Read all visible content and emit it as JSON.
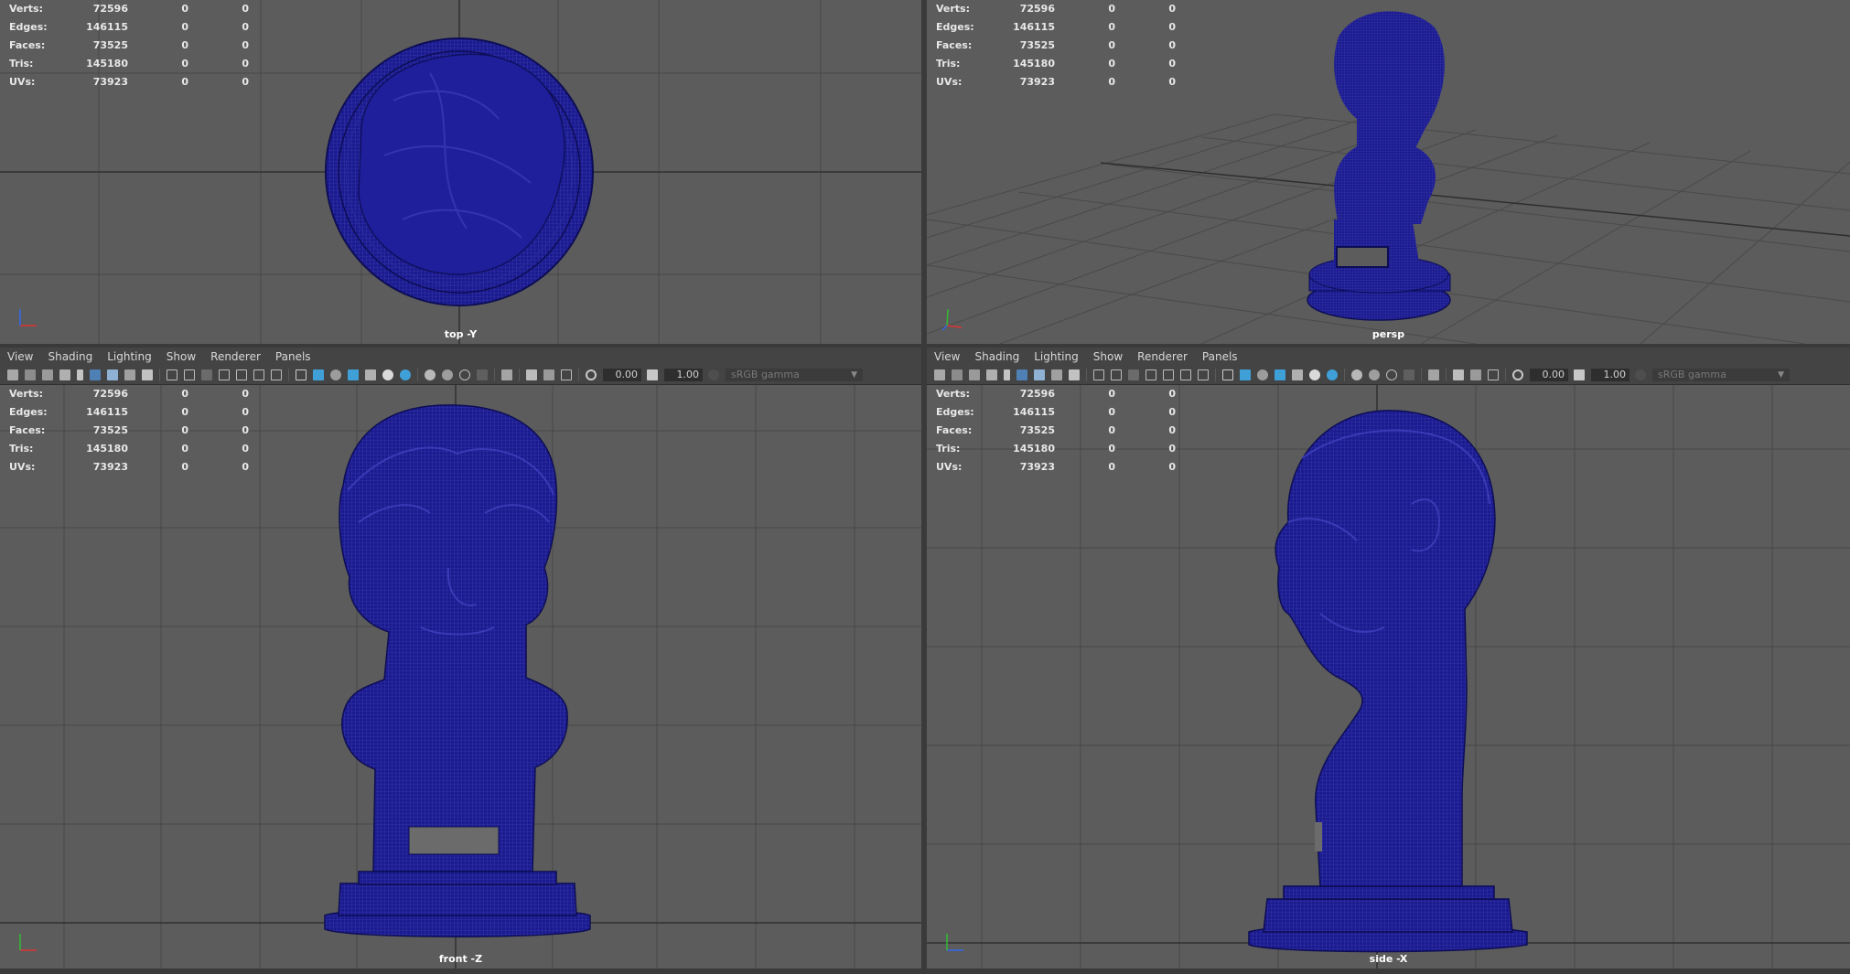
{
  "stats_labels": [
    "Verts:",
    "Edges:",
    "Faces:",
    "Tris:",
    "UVs:"
  ],
  "stats_values": [
    [
      "72596",
      "0",
      "0"
    ],
    [
      "146115",
      "0",
      "0"
    ],
    [
      "73525",
      "0",
      "0"
    ],
    [
      "145180",
      "0",
      "0"
    ],
    [
      "73923",
      "0",
      "0"
    ]
  ],
  "panel_menu": [
    "View",
    "Shading",
    "Lighting",
    "Show",
    "Renderer",
    "Panels"
  ],
  "toolbar": {
    "exposure": "0.00",
    "gamma_value": "1.00",
    "color_space": "sRGB gamma"
  },
  "viewports": {
    "top": {
      "camera": "top -Y"
    },
    "persp": {
      "camera": "persp"
    },
    "front": {
      "camera": "front -Z"
    },
    "side": {
      "camera": "side -X"
    }
  },
  "colors": {
    "viewport_bg": "#5c5c5c",
    "mesh_wire": "#1b1b90",
    "grid_line": "#454545",
    "grid_axis": "#303030",
    "ui_bar": "#444444"
  },
  "icons": [
    "camera-icon",
    "camera-attributes-icon",
    "bookmark-icon",
    "image-plane-icon",
    "grid-icon",
    "wireframe-icon",
    "smooth-shade-icon",
    "textured-icon",
    "lighting-icon",
    "shadows-icon",
    "isolate-select-icon",
    "xray-icon",
    "exposure-icon",
    "gamma-icon"
  ]
}
